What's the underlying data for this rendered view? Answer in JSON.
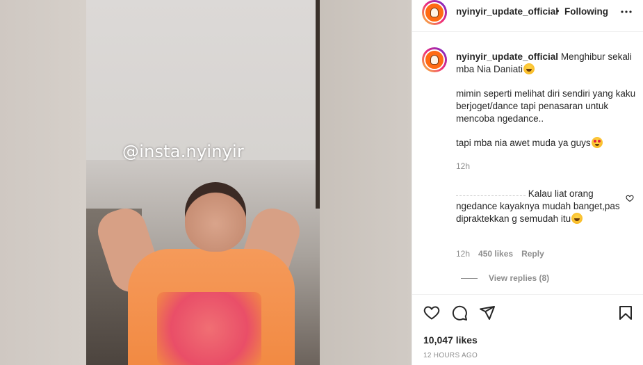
{
  "media": {
    "watermark": "@insta.nyinyir"
  },
  "header": {
    "username": "nyinyir_update_official",
    "separator": "•",
    "follow_status": "Following"
  },
  "caption": {
    "username": "nyinyir_update_official",
    "line1": "Menghibur sekali mba Nia Daniati",
    "para2": "mimin seperti melihat diri sendiri yang kaku berjoget/dance tapi penasaran untuk mencoba ngedance..",
    "para3": "tapi mba nia awet muda ya guys",
    "time": "12h"
  },
  "comment": {
    "text": "Kalau liat orang ngedance kayaknya mudah banget,pas dipraktekkan g semudah itu",
    "time": "12h",
    "likes": "450 likes",
    "reply_label": "Reply",
    "view_replies": "View replies (8)"
  },
  "actions": {
    "likes_count": "10,047 likes",
    "time_ago": "12 HOURS AGO"
  },
  "colors": {
    "text": "#262626",
    "secondary": "#8e8e8e",
    "border": "#efefef",
    "avatar_bg": "#ff6a13"
  },
  "icons": [
    "more-icon",
    "heart-icon",
    "comment-icon",
    "share-icon",
    "bookmark-icon",
    "comment-like-icon"
  ]
}
